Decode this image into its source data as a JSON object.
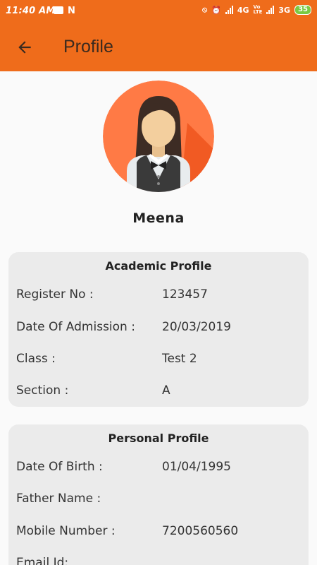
{
  "status_bar": {
    "time": "11:40 AM",
    "right_text_1": "4G",
    "right_text_2": "3G",
    "battery": "35"
  },
  "header": {
    "title": "Profile"
  },
  "profile": {
    "name": "Meena"
  },
  "academic": {
    "title": "Academic Profile",
    "rows": [
      {
        "label": "Register No :",
        "value": "123457"
      },
      {
        "label": "Date Of Admission :",
        "value": "20/03/2019"
      },
      {
        "label": "Class :",
        "value": "Test 2"
      },
      {
        "label": "Section :",
        "value": "A"
      }
    ]
  },
  "personal": {
    "title": "Personal Profile",
    "rows": [
      {
        "label": "Date Of Birth :",
        "value": "01/04/1995"
      },
      {
        "label": "Father Name :",
        "value": ""
      },
      {
        "label": "Mobile Number :",
        "value": "7200560560"
      },
      {
        "label": "Email Id:",
        "value": ""
      }
    ]
  },
  "colors": {
    "appbar": "#ef6c1b",
    "avatar_bg": "#ff7a45",
    "card_bg": "#ebebeb"
  }
}
